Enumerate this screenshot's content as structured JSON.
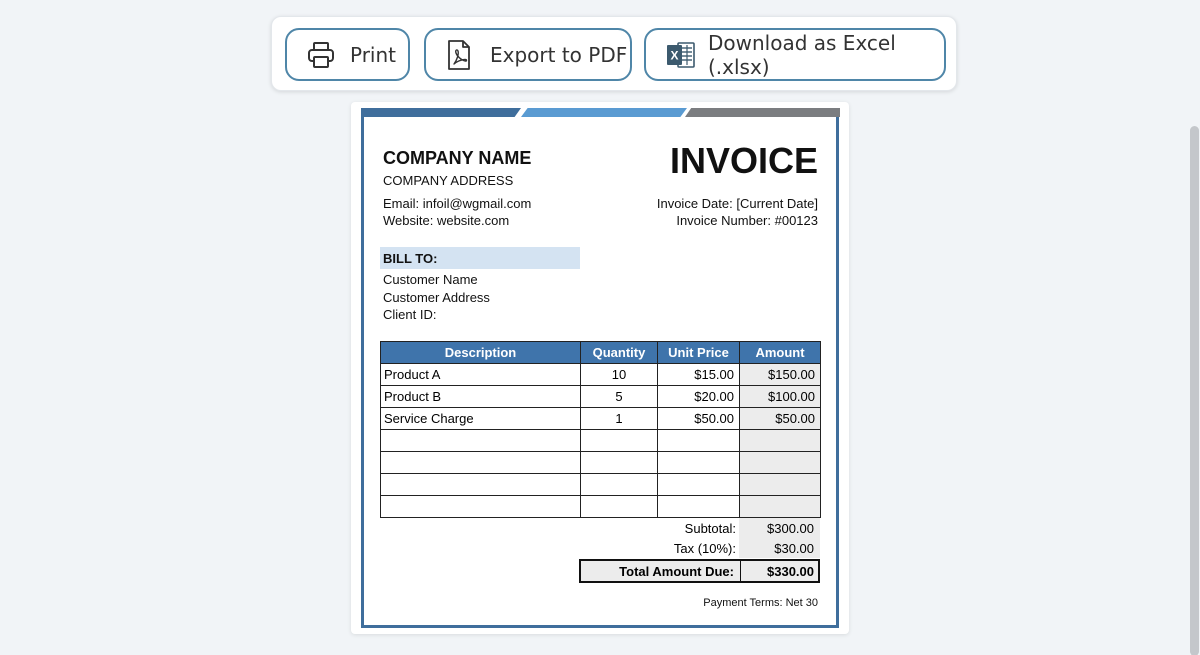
{
  "toolbar": {
    "print_label": "Print",
    "pdf_label": "Export to PDF",
    "excel_label": "Download as Excel (.xlsx)",
    "excel_icon_letter": "X"
  },
  "invoice": {
    "company_name": "COMPANY NAME",
    "company_address": "COMPANY ADDRESS",
    "email": "Email: infoil@wgmail.com",
    "website": "Website: website.com",
    "title": "INVOICE",
    "date": "Invoice Date: [Current Date]",
    "number": "Invoice Number: #00123",
    "bill_to": {
      "label": "BILL TO:",
      "customer_name": "Customer Name",
      "customer_address": "Customer Address",
      "client_id": "Client ID:"
    },
    "table": {
      "headers": [
        "Description",
        "Quantity",
        "Unit Price",
        "Amount"
      ],
      "rows": [
        [
          "Product A",
          "10",
          "$15.00",
          "$150.00"
        ],
        [
          "Product B",
          "5",
          "$20.00",
          "$100.00"
        ],
        [
          "Service Charge",
          "1",
          "$50.00",
          "$50.00"
        ],
        [
          "",
          "",
          "",
          ""
        ],
        [
          "",
          "",
          "",
          ""
        ],
        [
          "",
          "",
          "",
          ""
        ],
        [
          "",
          "",
          "",
          ""
        ]
      ]
    },
    "totals": {
      "subtotal_label": "Subtotal:",
      "subtotal_value": "$300.00",
      "tax_label": "Tax (10%):",
      "tax_value": "$30.00",
      "total_label": "Total Amount Due:",
      "total_value": "$330.00"
    },
    "payment_terms": "Payment Terms: Net 30"
  },
  "colors": {
    "accent_dark": "#3f6e9c",
    "accent_light": "#5a9bd2",
    "accent_gray": "#7b7d80",
    "table_header": "#3f74ab",
    "billto_bg": "#d4e3f2",
    "excel_green": "#3c5a6e"
  },
  "icons": {
    "print": "printer-icon",
    "pdf": "pdf-file-icon",
    "excel": "excel-file-icon"
  }
}
